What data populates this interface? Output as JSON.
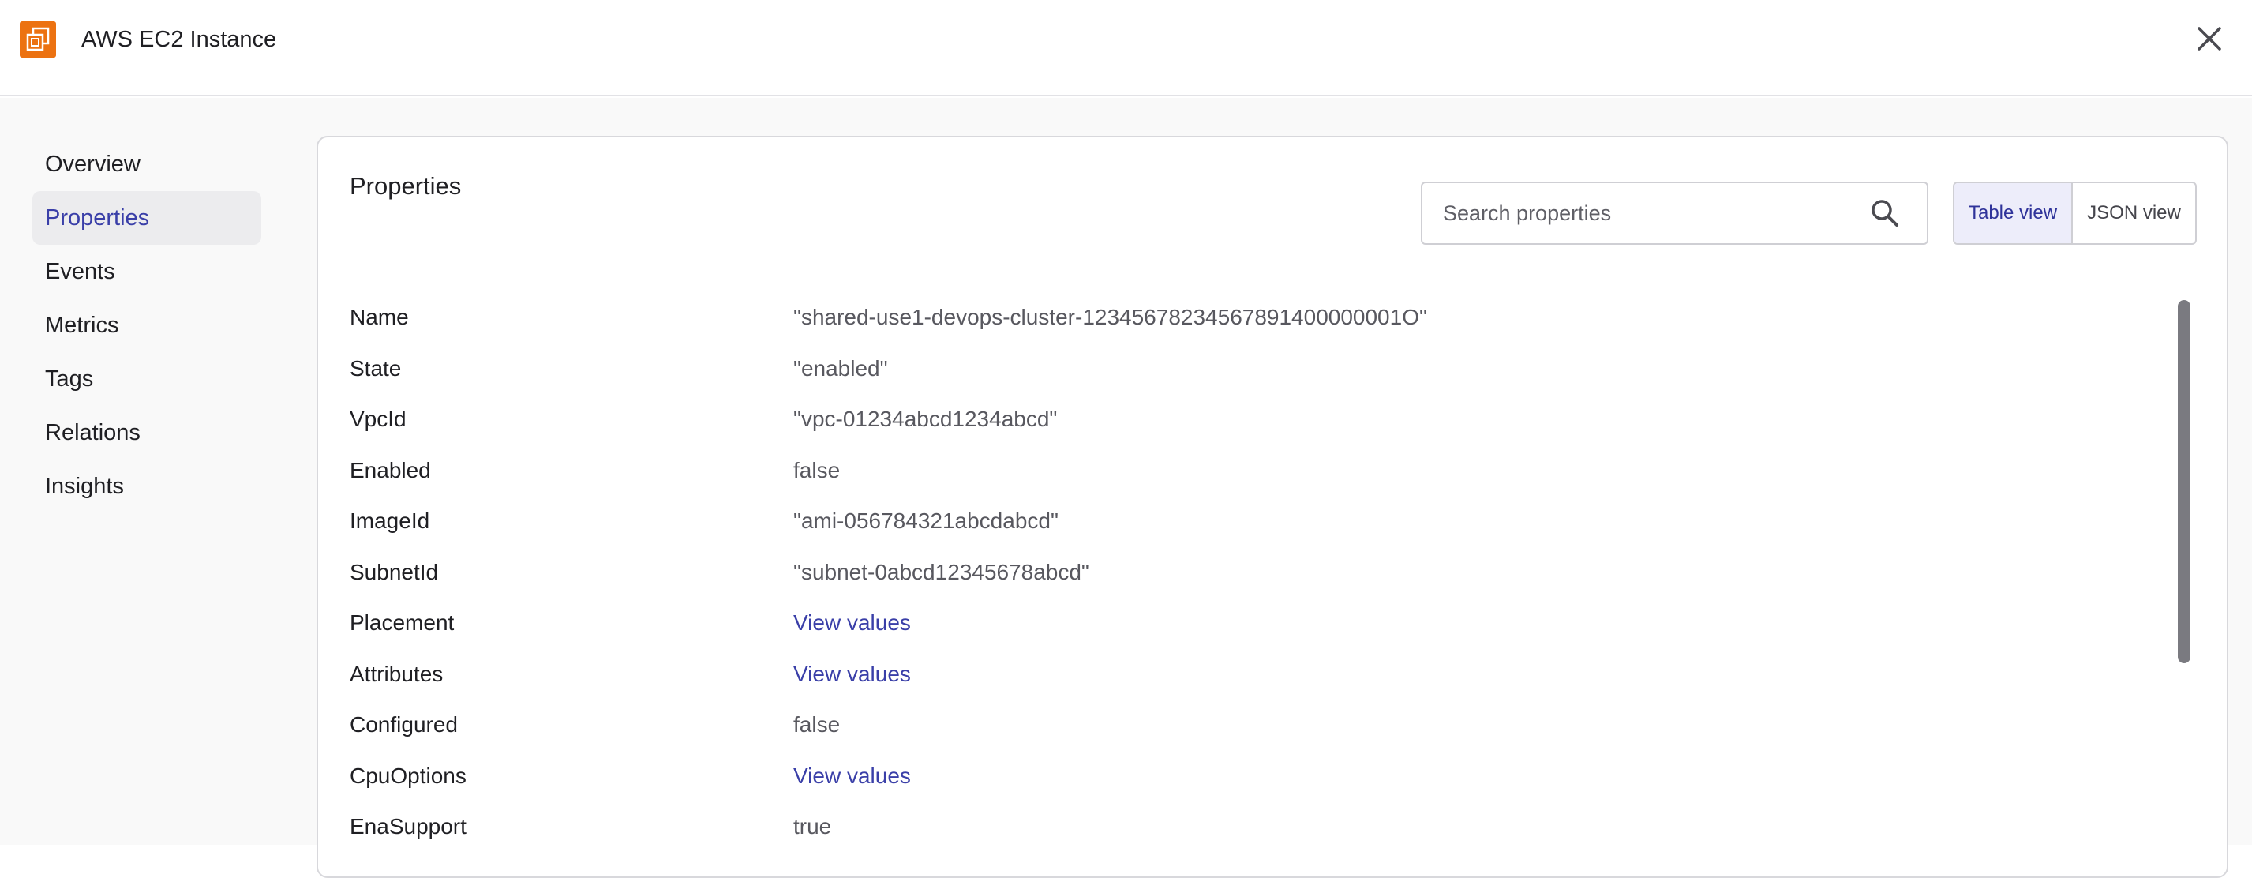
{
  "header": {
    "title": "AWS EC2 Instance",
    "icon": "ec2-instance-icon",
    "icon_color": "#ec7211",
    "close_icon": "close-icon"
  },
  "sidebar": {
    "items": [
      {
        "label": "Overview",
        "active": false
      },
      {
        "label": "Properties",
        "active": true
      },
      {
        "label": "Events",
        "active": false
      },
      {
        "label": "Metrics",
        "active": false
      },
      {
        "label": "Tags",
        "active": false
      },
      {
        "label": "Relations",
        "active": false
      },
      {
        "label": "Insights",
        "active": false
      }
    ],
    "accent_color": "#3a3fa8"
  },
  "main": {
    "title": "Properties",
    "search": {
      "placeholder": "Search properties",
      "value": ""
    },
    "view_toggle": {
      "table_label": "Table view",
      "json_label": "JSON view",
      "selected": "Table view"
    },
    "properties": [
      {
        "key": "Name",
        "value": "\"shared-use1-devops-cluster-12345678234567891400000001O\"",
        "is_link": false
      },
      {
        "key": "State",
        "value": "\"enabled\"",
        "is_link": false
      },
      {
        "key": "VpcId",
        "value": "\"vpc-01234abcd1234abcd\"",
        "is_link": false
      },
      {
        "key": "Enabled",
        "value": "false",
        "is_link": false
      },
      {
        "key": "ImageId",
        "value": "\"ami-056784321abcdabcd\"",
        "is_link": false
      },
      {
        "key": "SubnetId",
        "value": "\"subnet-0abcd12345678abcd\"",
        "is_link": false
      },
      {
        "key": "Placement",
        "value": "View values",
        "is_link": true
      },
      {
        "key": "Attributes",
        "value": "View values",
        "is_link": true
      },
      {
        "key": "Configured",
        "value": "false",
        "is_link": false
      },
      {
        "key": "CpuOptions",
        "value": "View values",
        "is_link": true
      },
      {
        "key": "EnaSupport",
        "value": "true",
        "is_link": false
      }
    ]
  }
}
